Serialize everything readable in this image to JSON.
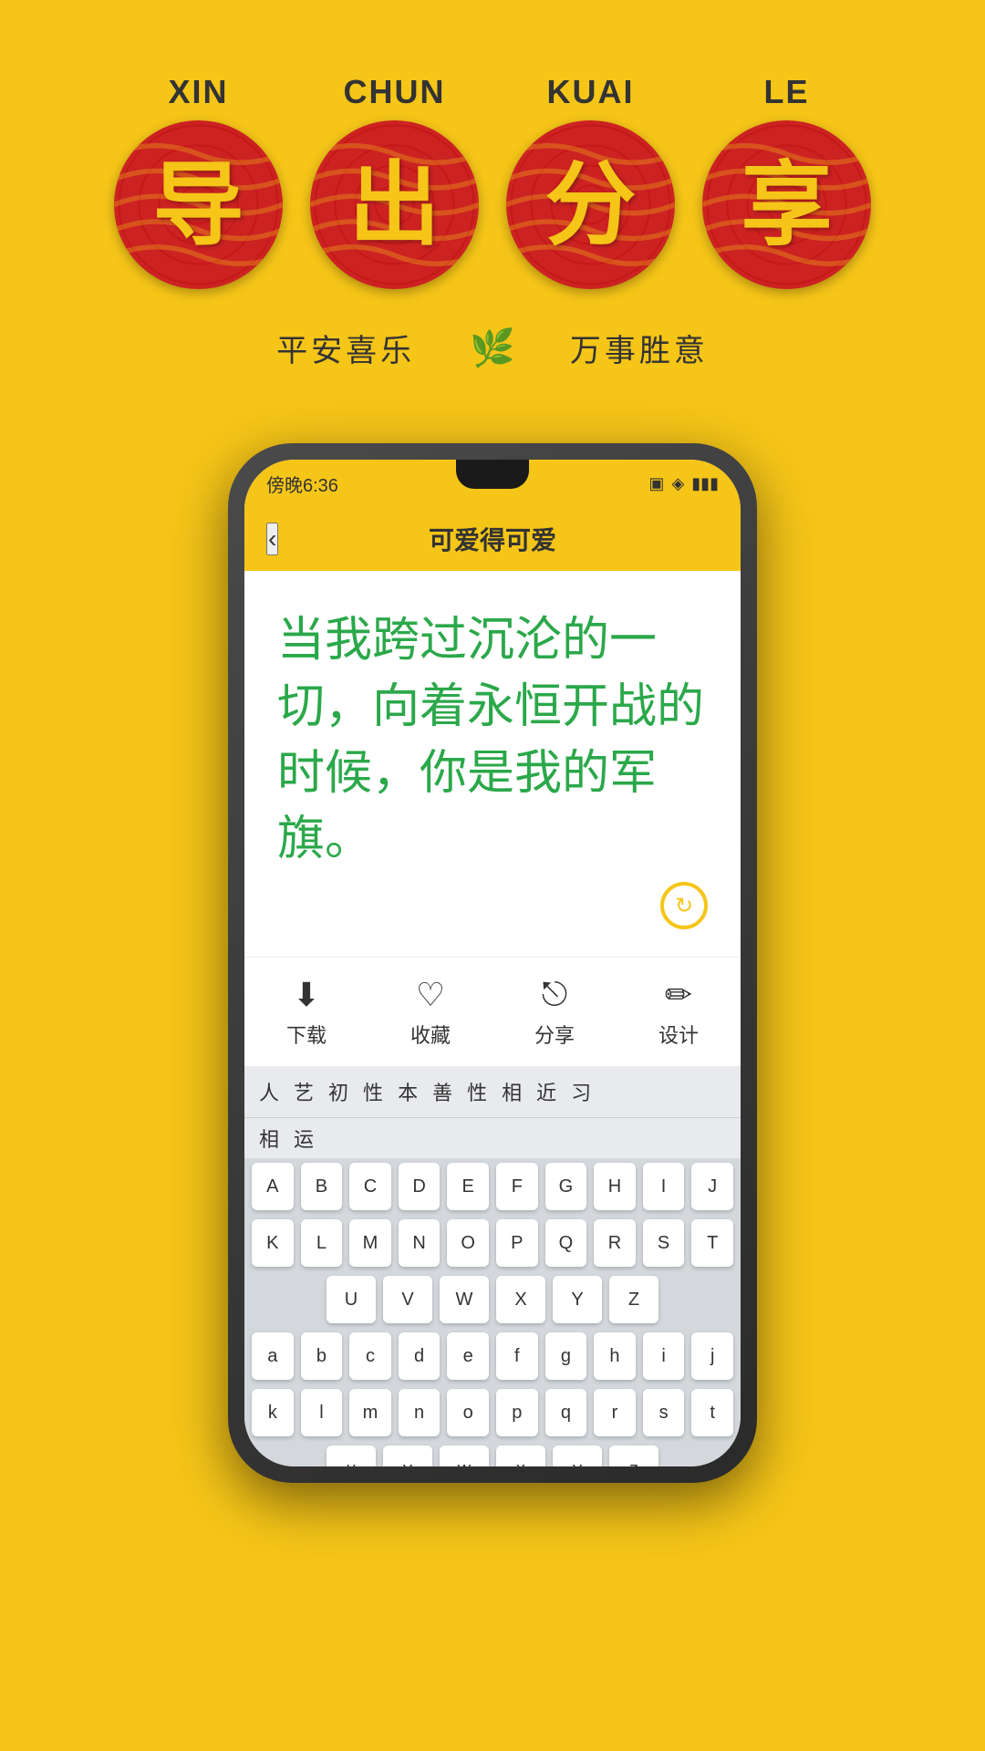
{
  "background_color": "#F5C518",
  "top_section": {
    "items": [
      {
        "pinyin": "XIN",
        "char": "导"
      },
      {
        "pinyin": "CHUN",
        "char": "出"
      },
      {
        "pinyin": "KUAI",
        "char": "分"
      },
      {
        "pinyin": "LE",
        "char": "享"
      }
    ],
    "subtitle_left": "平安喜乐",
    "subtitle_right": "万事胜意",
    "lotus_symbol": "🌿"
  },
  "phone": {
    "status_bar": {
      "time": "傍晚6:36",
      "icons": "📶 🔋"
    },
    "header": {
      "back_label": "‹",
      "title": "可爱得可爱"
    },
    "content": {
      "main_text": "当我跨过沉沦的一切，向着永恒开战的时候，你是我的军旗。"
    },
    "toolbar": {
      "items": [
        {
          "icon": "⬇",
          "label": "下载"
        },
        {
          "icon": "♡",
          "label": "收藏"
        },
        {
          "icon": "⎋",
          "label": "分享"
        },
        {
          "icon": "✏",
          "label": "设计"
        }
      ]
    },
    "keyboard": {
      "suggestions": [
        "人",
        "艺",
        "初",
        "性",
        "本",
        "善",
        "性",
        "相",
        "近",
        "习"
      ],
      "row2_suggestions": [
        "相",
        "运"
      ],
      "rows_upper": [
        [
          "A",
          "B",
          "C",
          "D",
          "E",
          "F",
          "G",
          "H",
          "I",
          "J"
        ],
        [
          "K",
          "L",
          "M",
          "N",
          "O",
          "P",
          "Q",
          "R",
          "S",
          "T"
        ],
        [
          "U",
          "V",
          "W",
          "X",
          "Y",
          "Z"
        ]
      ],
      "rows_lower": [
        [
          "a",
          "b",
          "c",
          "d",
          "e",
          "f",
          "g",
          "h",
          "i",
          "j"
        ],
        [
          "k",
          "l",
          "m",
          "n",
          "o",
          "p",
          "q",
          "r",
          "s",
          "t"
        ],
        [
          "u",
          "v",
          "w",
          "x",
          "y",
          "z"
        ]
      ]
    }
  }
}
